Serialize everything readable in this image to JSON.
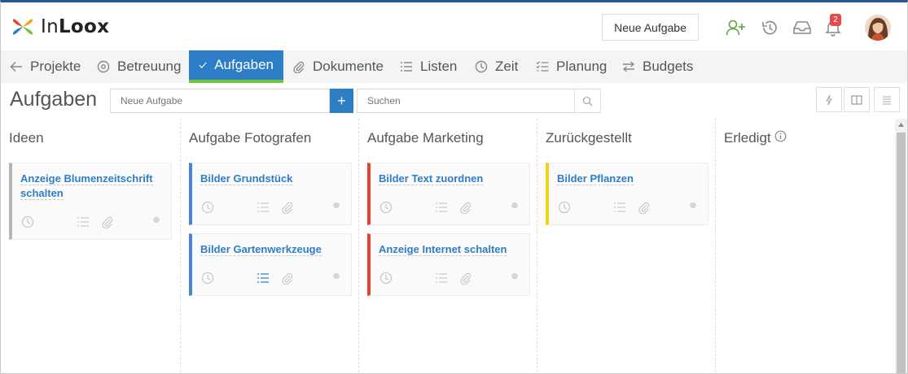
{
  "app": {
    "logo_text_regular": "In",
    "logo_text_bold": "Loox"
  },
  "header": {
    "new_task_label": "Neue Aufgabe",
    "notification_count": "2",
    "icons": [
      "add-user-icon",
      "history-icon",
      "inbox-icon",
      "bell-icon",
      "avatar"
    ]
  },
  "nav": {
    "items": [
      {
        "label": "Projekte",
        "icon": "arrow-left-icon"
      },
      {
        "label": "Betreuung",
        "icon": "target-icon"
      },
      {
        "label": "Aufgaben",
        "icon": "check-icon",
        "active": true
      },
      {
        "label": "Dokumente",
        "icon": "paperclip-icon"
      },
      {
        "label": "Listen",
        "icon": "list-icon"
      },
      {
        "label": "Zeit",
        "icon": "clock-icon"
      },
      {
        "label": "Planung",
        "icon": "checklist-icon"
      },
      {
        "label": "Budgets",
        "icon": "exchange-icon"
      }
    ]
  },
  "toolbar": {
    "page_title": "Aufgaben",
    "quick_add_placeholder": "Neue Aufgabe",
    "add_button_label": "+",
    "search_placeholder": "Suchen"
  },
  "board": {
    "columns": [
      {
        "title": "Ideen",
        "cards": [
          {
            "title": "Anzeige Blumenzeitschrift schalten",
            "color": "#b5b5b5"
          }
        ]
      },
      {
        "title": "Aufgabe Fotografen",
        "cards": [
          {
            "title": "Bilder Grundstück",
            "color": "#4a86c8"
          },
          {
            "title": "Bilder Gartenwerkzeuge",
            "color": "#4a86c8",
            "checklist_active": true
          }
        ]
      },
      {
        "title": "Aufgabe Marketing",
        "cards": [
          {
            "title": "Bilder Text zuordnen",
            "color": "#e8412c"
          },
          {
            "title": "Anzeige Internet schalten",
            "color": "#e8412c",
            "comment_active": true
          }
        ]
      },
      {
        "title": "Zurückgestellt",
        "cards": [
          {
            "title": "Bilder Pflanzen",
            "color": "#f2d31b"
          }
        ]
      },
      {
        "title": "Erledigt",
        "info_icon": true,
        "cards": []
      }
    ]
  },
  "colors": {
    "accent": "#2d7ec7",
    "active_underline": "#71c23c",
    "badge": "#e64b4b",
    "top_border": "#2a5593"
  }
}
